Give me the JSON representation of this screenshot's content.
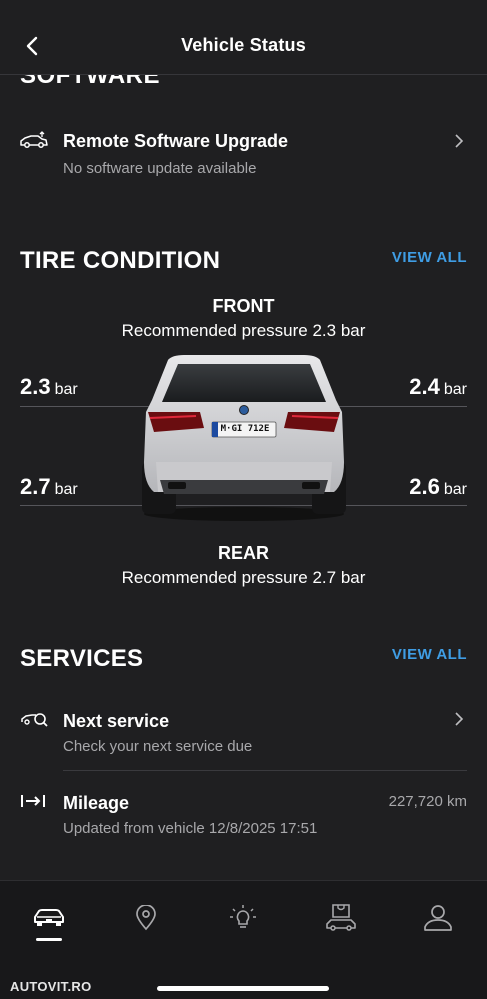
{
  "header": {
    "title": "Vehicle Status"
  },
  "software": {
    "heading": "SOFTWARE",
    "row_title": "Remote Software Upgrade",
    "row_sub": "No software update available"
  },
  "tire": {
    "heading": "TIRE CONDITION",
    "view_all": "VIEW ALL",
    "front_label": "FRONT",
    "front_recommended": "Recommended pressure 2.3 bar",
    "rear_label": "REAR",
    "rear_recommended": "Recommended pressure 2.7 bar",
    "front_left": "2.3",
    "front_right": "2.4",
    "rear_left": "2.7",
    "rear_right": "2.6",
    "unit": "bar",
    "plate": "M·GI 712E"
  },
  "services": {
    "heading": "SERVICES",
    "view_all": "VIEW ALL",
    "next_title": "Next service",
    "next_sub": "Check your next service due",
    "mileage_title": "Mileage",
    "mileage_value": "227,720 km",
    "mileage_sub": "Updated from vehicle 12/8/2025 17:51"
  },
  "nav": {
    "items": [
      "car-icon",
      "location-pin-icon",
      "lightbulb-icon",
      "shop-car-icon",
      "profile-icon"
    ],
    "active_index": 0
  },
  "watermark": "AUTOVIT.RO",
  "colors": {
    "background": "#1f1f21",
    "accent": "#3f9de4",
    "secondary_text": "#a8a8ab"
  }
}
